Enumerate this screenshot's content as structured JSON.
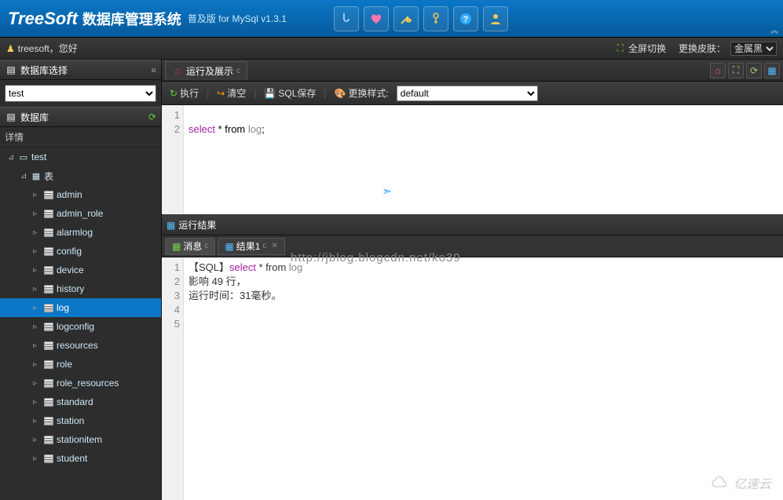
{
  "header": {
    "logo": "TreeSoft",
    "title": "数据库管理系统",
    "subtitle": "普及版 for MySql v1.3.1"
  },
  "userbar": {
    "greeting": "treesoft，您好",
    "fullscreen": "全屏切换",
    "skin_label": "更换皮肤：",
    "skin_selected": "金属黑"
  },
  "sidebar": {
    "select_panel": "数据库选择",
    "selected_db": "test",
    "db_panel": "数据库",
    "detail_label": "详情",
    "tree": {
      "root": "test",
      "tables_label": "表",
      "tables": [
        "admin",
        "admin_role",
        "alarmlog",
        "config",
        "device",
        "history",
        "log",
        "logconfig",
        "resources",
        "role",
        "role_resources",
        "standard",
        "station",
        "stationitem",
        "student"
      ],
      "selected": "log"
    }
  },
  "tabs": {
    "main": "运行及展示"
  },
  "sqlbar": {
    "execute": "执行",
    "clear": "清空",
    "save": "SQL保存",
    "style": "更换样式:",
    "style_selected": "default"
  },
  "editor": {
    "lines": [
      "",
      "select * from log;"
    ]
  },
  "result": {
    "panel": "运行结果",
    "tabs": {
      "messages": "消息",
      "result1": "结果1"
    },
    "lines": {
      "l1_prefix": "【SQL】",
      "l1_sql_kw": "select",
      "l1_sql_rest": " * from ",
      "l1_tbl": "log",
      "l2": "影响 49 行，",
      "l3": "运行时间：31毫秒。"
    }
  },
  "watermark": {
    "url_overlay": "http://jblog.blogcdn.net/ko39",
    "brand": "亿速云"
  }
}
